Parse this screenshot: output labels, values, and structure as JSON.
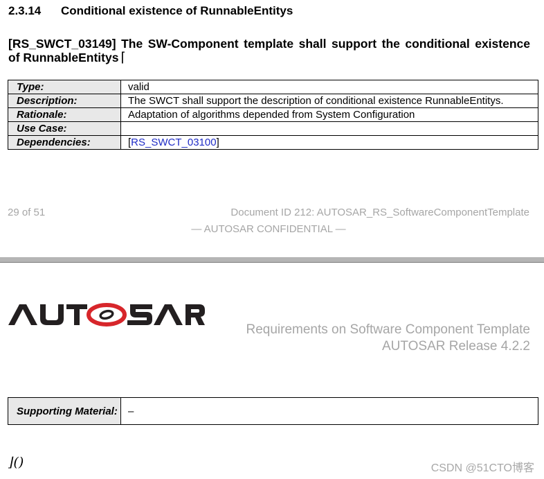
{
  "section": {
    "number": "2.3.14",
    "title": "Conditional existence of RunnableEntitys"
  },
  "requirement": {
    "title": "[RS_SWCT_03149] The SW-Component template shall support the conditional existence of RunnableEntitys",
    "open_bracket": "⌈",
    "close_bracket": "⌋()"
  },
  "table1": {
    "rows": [
      {
        "label": "Type:",
        "value": "valid"
      },
      {
        "label": "Description:",
        "value": "The SWCT shall support the description of conditional existence RunnableEntitys."
      },
      {
        "label": "Rationale:",
        "value": "Adaptation of algorithms depended from System Configuration"
      },
      {
        "label": "Use Case:",
        "value": ""
      },
      {
        "label": "Dependencies:",
        "value_prefix": "[",
        "link": "RS_SWCT_03100",
        "value_suffix": "]"
      }
    ]
  },
  "footer": {
    "page": "29 of 51",
    "document_id": "Document ID 212: AUTOSAR_RS_SoftwareComponentTemplate",
    "confidential": "— AUTOSAR CONFIDENTIAL —"
  },
  "header": {
    "logo_text": "AUTOSAR",
    "doc_title": "Requirements on Software Component Template",
    "release": "AUTOSAR Release 4.2.2"
  },
  "table2": {
    "rows": [
      {
        "label": "Supporting Material:",
        "value": "–"
      }
    ]
  },
  "watermark": "CSDN @51CTO博客",
  "colors": {
    "link": "#1f2cc6",
    "footer_gray": "#a6a6a6",
    "label_bg": "#e8e8e8",
    "logo_red": "#d7262b",
    "logo_dark": "#231f20"
  }
}
